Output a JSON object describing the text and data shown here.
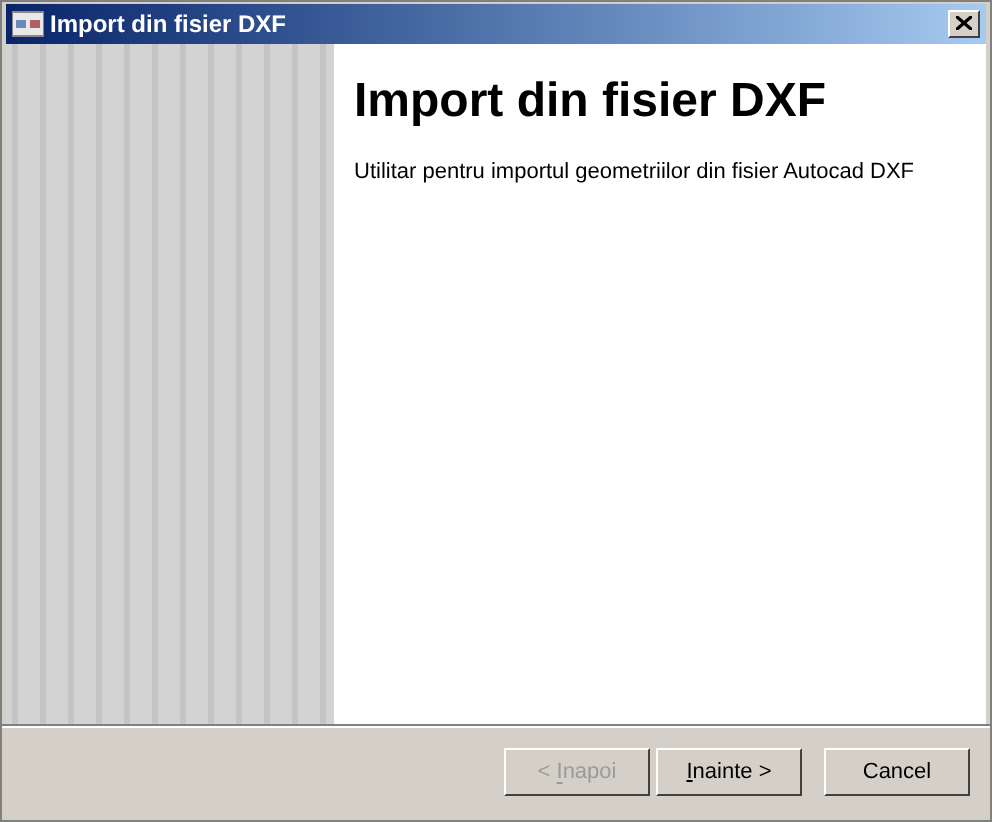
{
  "window": {
    "title": "Import din fisier DXF"
  },
  "heading": "Import din fisier DXF",
  "description": "Utilitar pentru importul geometriilor din fisier Autocad DXF",
  "buttons": [
    {
      "label": "< Inapoi",
      "disabled": true,
      "accelerator": true
    },
    {
      "label": "Inainte >",
      "disabled": false,
      "accelerator": true
    },
    {
      "label": "Cancel",
      "disabled": false,
      "accelerator": false
    }
  ]
}
